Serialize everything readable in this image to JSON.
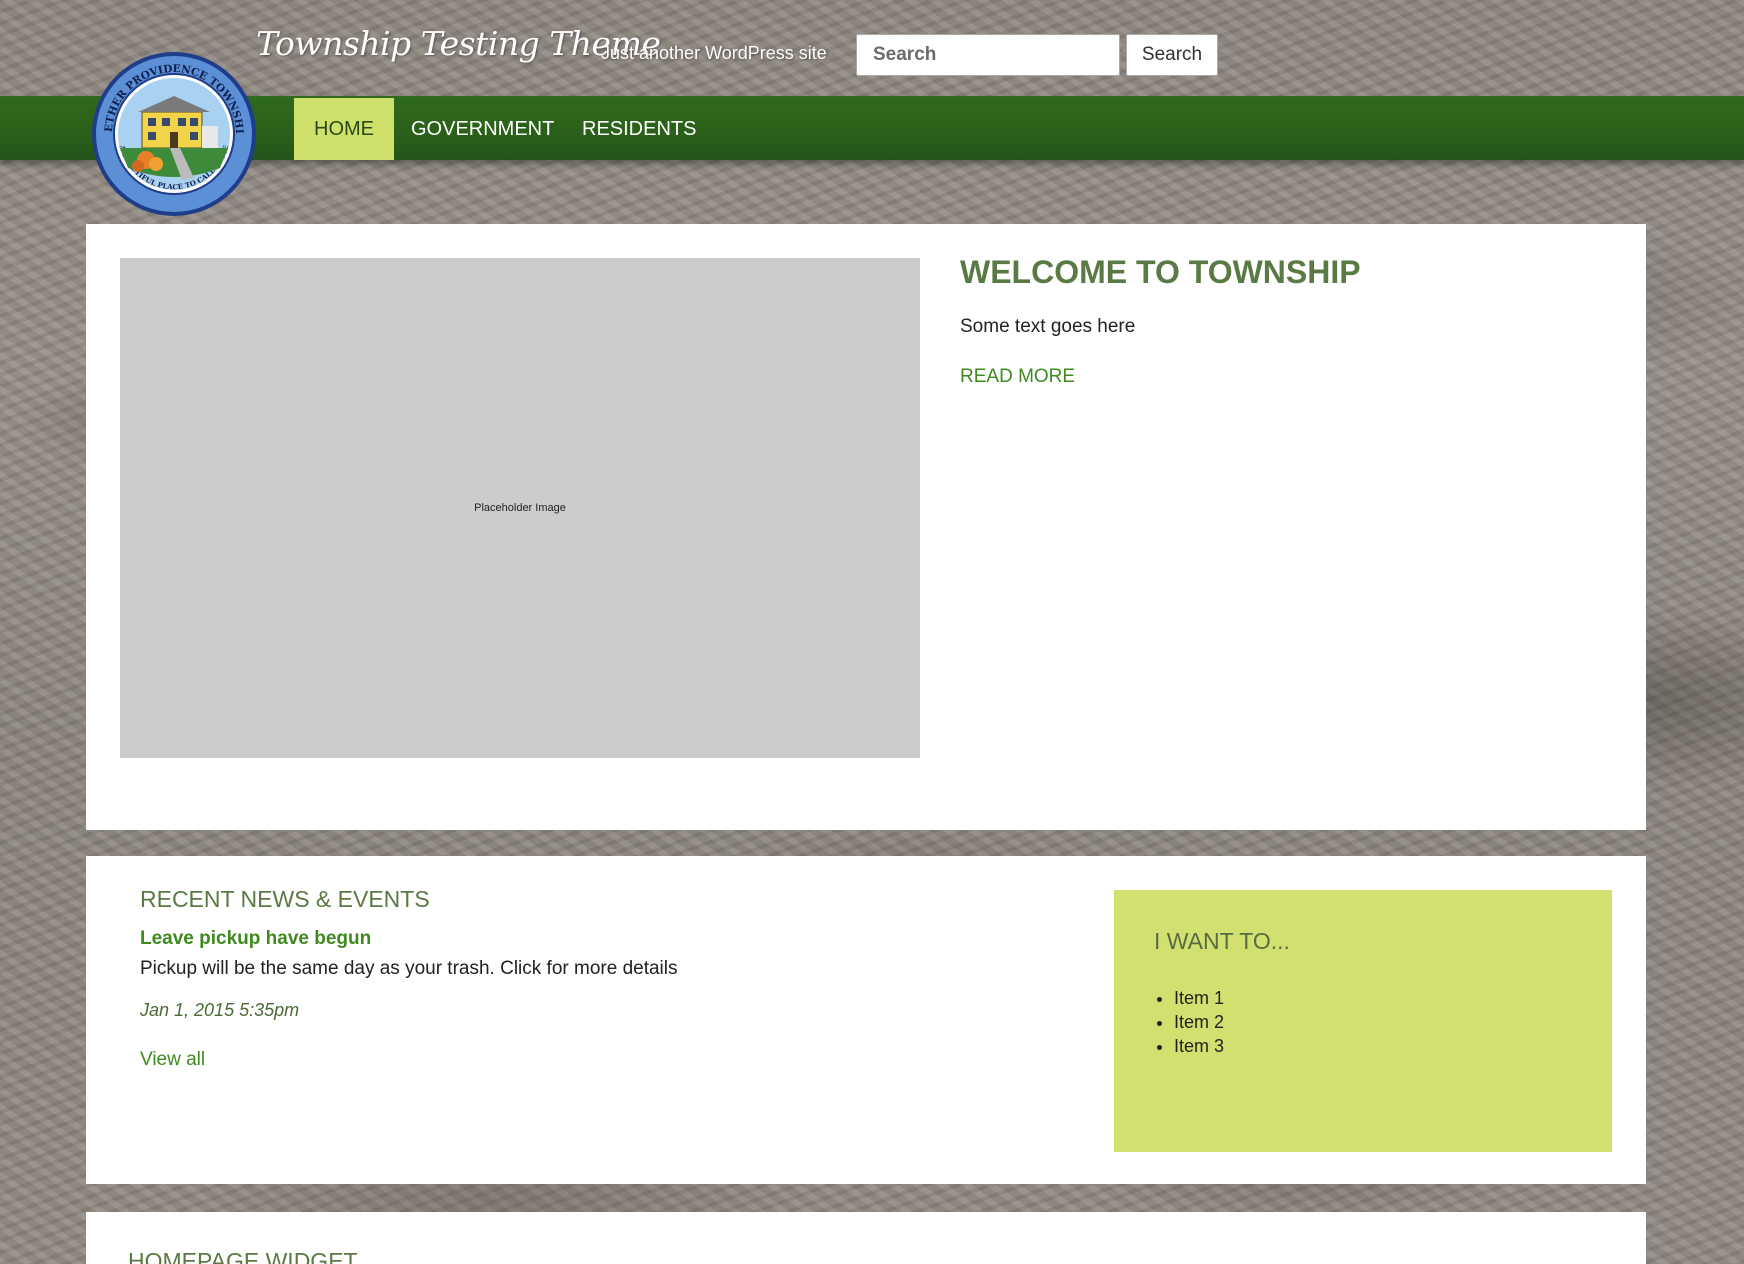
{
  "header": {
    "site_title": "Township Testing Theme",
    "tagline": "Just another WordPress site",
    "search_placeholder": "Search",
    "search_button_label": "Search"
  },
  "logo": {
    "top_text": "NETHER PROVIDENCE TOWNSHIP",
    "bottom_text": "A BEAUTIFUL PLACE TO CALL HOME"
  },
  "nav": {
    "items": [
      {
        "label": "HOME",
        "active": true
      },
      {
        "label": "GOVERNMENT",
        "active": false
      },
      {
        "label": "RESIDENTS",
        "active": false
      }
    ]
  },
  "hero": {
    "placeholder_label": "Placeholder Image",
    "title": "WELCOME TO TOWNSHIP",
    "text": "Some text goes here",
    "read_more": "READ MORE"
  },
  "news": {
    "title": "RECENT NEWS & EVENTS",
    "items": [
      {
        "headline": "Leave pickup have begun",
        "summary": "Pickup will be the same day as your trash. Click for more details",
        "date": "Jan 1, 2015 5:35pm"
      }
    ],
    "view_all": "View all"
  },
  "want_to": {
    "title": "I WANT TO...",
    "items": [
      "Item 1",
      "Item 2",
      "Item 3"
    ]
  },
  "widget": {
    "title": "HOMEPAGE WIDGET"
  },
  "colors": {
    "nav_green": "#2a6019",
    "accent_lime": "#cfe06b",
    "heading_green": "#5a7a45",
    "link_green": "#3f8a1f"
  }
}
